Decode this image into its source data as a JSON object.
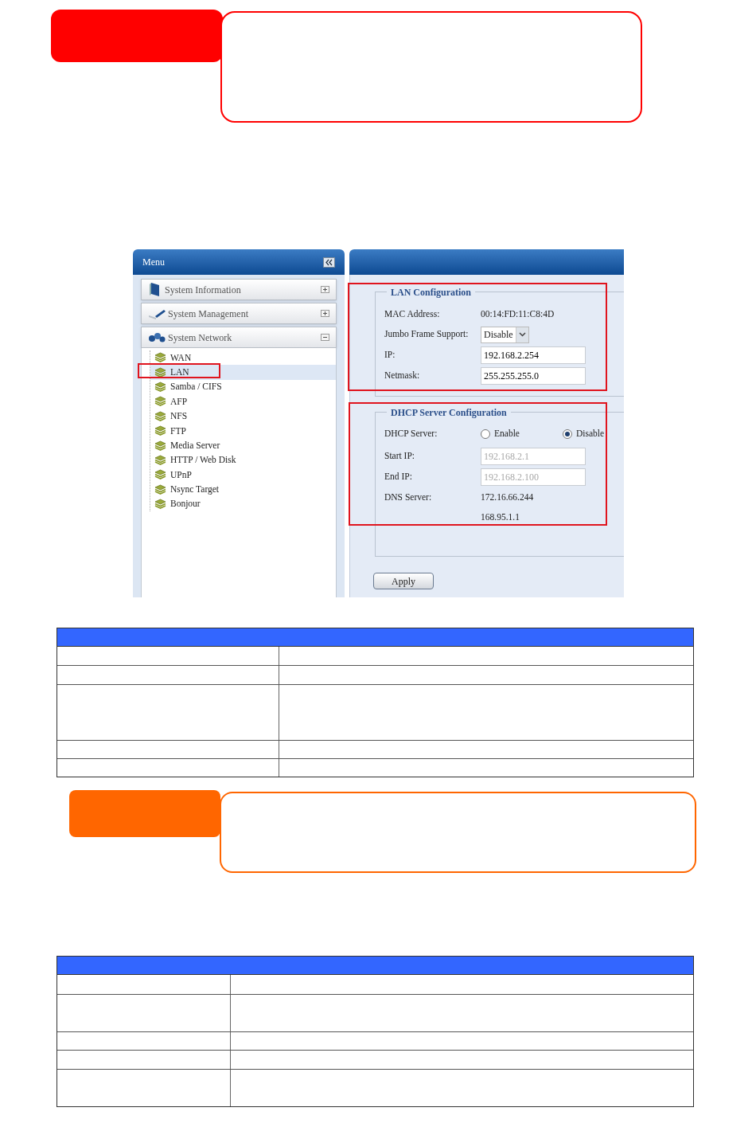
{
  "callouts": [
    {
      "color": "#ff0000"
    },
    {
      "color": "#ff6600"
    }
  ],
  "screenshot": {
    "menu": {
      "title": "Menu",
      "sections": [
        {
          "label": "System Information",
          "expanded": false
        },
        {
          "label": "System Management",
          "expanded": false
        },
        {
          "label": "System Network",
          "expanded": true,
          "children": [
            {
              "label": "WAN",
              "selected": false
            },
            {
              "label": "LAN",
              "selected": true
            },
            {
              "label": "Samba / CIFS",
              "selected": false
            },
            {
              "label": "AFP",
              "selected": false
            },
            {
              "label": "NFS",
              "selected": false
            },
            {
              "label": "FTP",
              "selected": false
            },
            {
              "label": "Media Server",
              "selected": false
            },
            {
              "label": "HTTP / Web Disk",
              "selected": false
            },
            {
              "label": "UPnP",
              "selected": false
            },
            {
              "label": "Nsync Target",
              "selected": false
            },
            {
              "label": "Bonjour",
              "selected": false
            }
          ]
        }
      ]
    },
    "lan_configuration": {
      "title": "LAN Configuration",
      "fields": [
        {
          "kind": "text",
          "label": "MAC Address:",
          "value": "00:14:FD:11:C8:4D"
        },
        {
          "kind": "select",
          "label": "Jumbo Frame Support:",
          "value": "Disable"
        },
        {
          "kind": "input",
          "label": "IP:",
          "value": "192.168.2.254",
          "disabled": false
        },
        {
          "kind": "input",
          "label": "Netmask:",
          "value": "255.255.255.0",
          "disabled": false
        }
      ]
    },
    "dhcp_configuration": {
      "title": "DHCP Server Configuration",
      "fields": [
        {
          "kind": "radio",
          "label": "DHCP Server:",
          "options": [
            {
              "label": "Enable",
              "selected": false
            },
            {
              "label": "Disable",
              "selected": true
            }
          ]
        },
        {
          "kind": "input",
          "label": "Start IP:",
          "value": "192.168.2.1",
          "disabled": true
        },
        {
          "kind": "input",
          "label": "End IP:",
          "value": "192.168.2.100",
          "disabled": true
        },
        {
          "kind": "text",
          "label": "DNS Server:",
          "value": "172.16.66.244"
        },
        {
          "kind": "text",
          "value": "168.95.1.1"
        }
      ]
    },
    "apply_button": "Apply"
  }
}
